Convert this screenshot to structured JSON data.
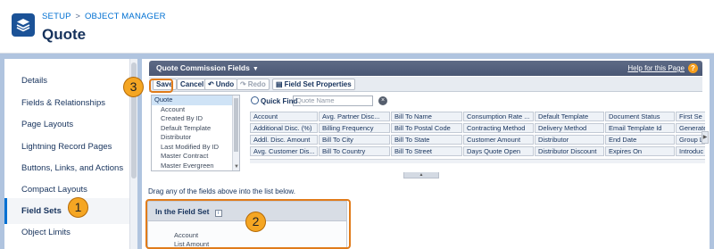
{
  "header": {
    "breadcrumb": [
      "SETUP",
      "OBJECT MANAGER"
    ],
    "breadcrumb_sep": ">",
    "title": "Quote",
    "icon": "layers-icon",
    "accent": "#1b5297"
  },
  "nav": {
    "items": [
      {
        "label": "Details"
      },
      {
        "label": "Fields & Relationships"
      },
      {
        "label": "Page Layouts"
      },
      {
        "label": "Lightning Record Pages"
      },
      {
        "label": "Buttons, Links, and Actions"
      },
      {
        "label": "Compact Layouts"
      },
      {
        "label": "Field Sets"
      },
      {
        "label": "Object Limits"
      }
    ],
    "active_index": 6
  },
  "palette": {
    "title": "Quote Commission Fields",
    "help_link": "Help for this Page",
    "toolbar": {
      "save": "Save",
      "cancel": "Cancel",
      "undo": "Undo",
      "redo": "Redo",
      "properties": "Field Set Properties"
    },
    "list": {
      "selected": "Quote",
      "items": [
        "Account",
        "Created By ID",
        "Default Template",
        "Distributor",
        "Last Modified By ID",
        "Master Contract",
        "Master Evergreen"
      ]
    },
    "quick_find": {
      "label": "Quick Find",
      "placeholder": "Quote Name",
      "clear": "×"
    },
    "grid": [
      [
        "Account",
        "Avg. Partner Disc...",
        "Bill To Name",
        "Consumption Rate ...",
        "Default Template",
        "Document Status",
        "First Se"
      ],
      [
        "Additional Disc. (%)",
        "Billing Frequency",
        "Bill To Postal Code",
        "Contracting Method",
        "Delivery Method",
        "Email Template Id",
        "Generate"
      ],
      [
        "Addl. Disc. Amount",
        "Bill To City",
        "Bill To State",
        "Customer Amount",
        "Distributor",
        "End Date",
        "Group Li"
      ],
      [
        "Avg. Customer Dis...",
        "Bill To Country",
        "Bill To Street",
        "Days Quote Open",
        "Distributor Discount",
        "Expires On",
        "Introduc"
      ]
    ]
  },
  "drag_help": "Drag any of the fields above into the list below.",
  "fieldset": {
    "title": "In the Field Set",
    "info": "i",
    "items": [
      "Account",
      "List Amount"
    ]
  },
  "callouts": {
    "one": "1",
    "two": "2",
    "three": "3",
    "color": "#f5a623"
  }
}
